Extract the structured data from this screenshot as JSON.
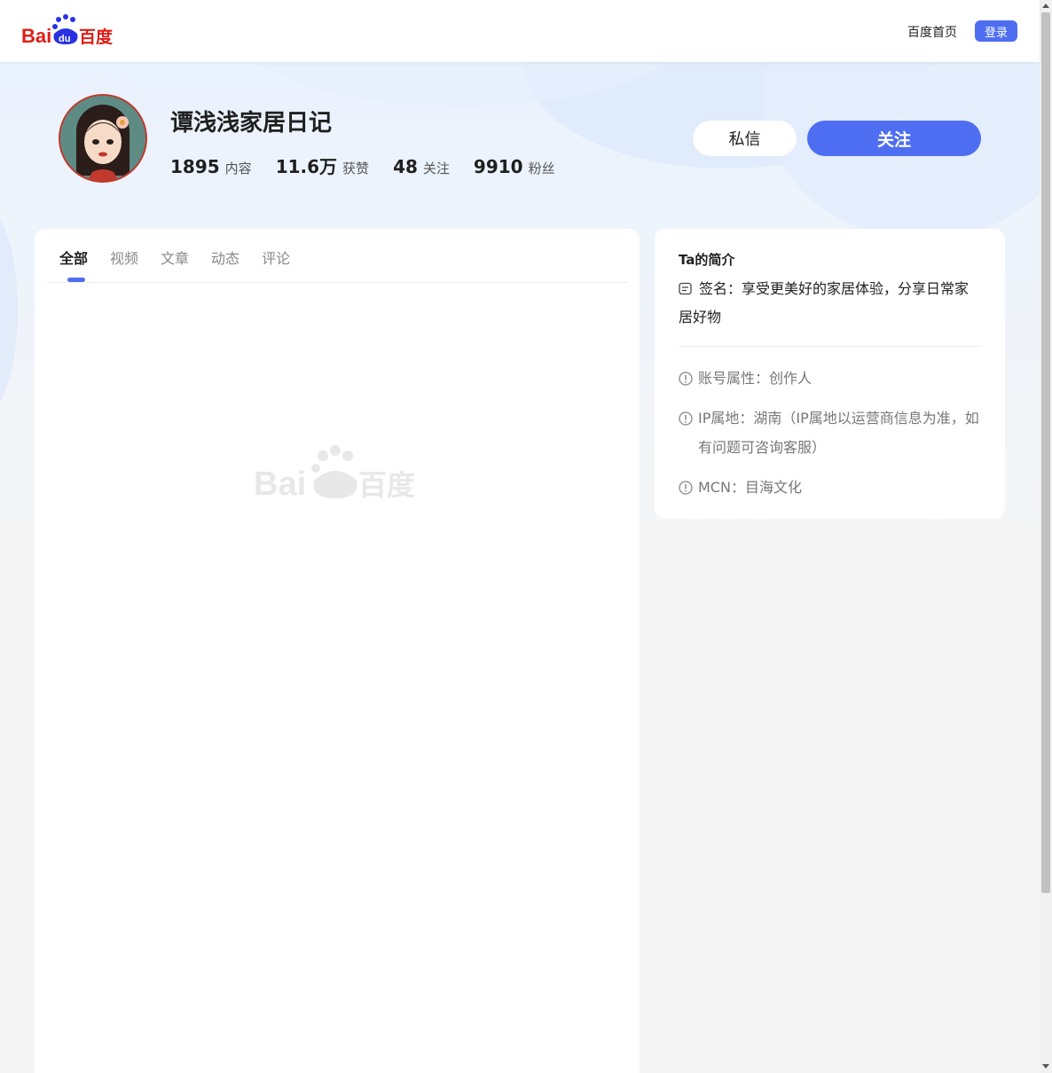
{
  "header": {
    "logo_text_left": "Bai",
    "logo_text_mid": "du",
    "logo_text_right": "百度",
    "home_link": "百度首页",
    "login_label": "登录"
  },
  "profile": {
    "name": "谭浅浅家居日记",
    "stats": [
      {
        "num": "1895",
        "label": "内容"
      },
      {
        "num": "11.6万",
        "label": "获赞"
      },
      {
        "num": "48",
        "label": "关注"
      },
      {
        "num": "9910",
        "label": "粉丝"
      }
    ],
    "message_label": "私信",
    "follow_label": "关注"
  },
  "tabs": [
    "全部",
    "视频",
    "文章",
    "动态",
    "评论"
  ],
  "intro": {
    "title": "Ta的简介",
    "signature": "签名：享受更美好的家居体验，分享日常家居好物",
    "account_type": "账号属性：创作人",
    "ip": "IP属地：湖南（IP属地以运营商信息为准，如有问题可咨询客服）",
    "mcn": "MCN：目海文化"
  },
  "colors": {
    "accent": "#4e6ef2",
    "logo_red": "#de1e15",
    "logo_blue": "#2932e1"
  }
}
